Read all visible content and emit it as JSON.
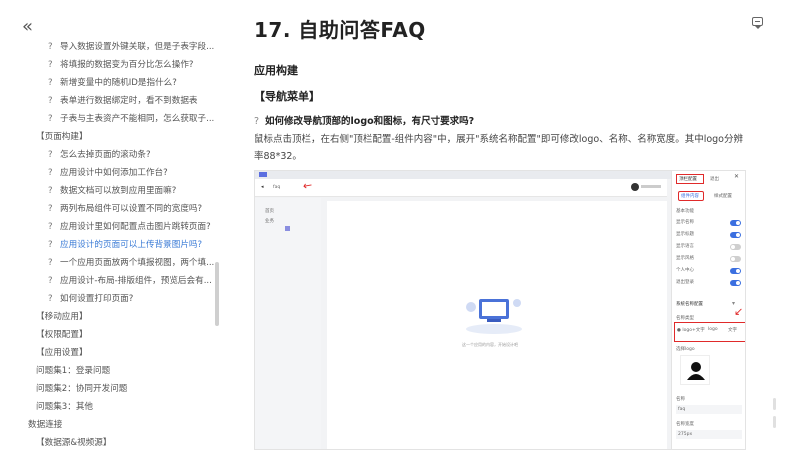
{
  "sidebar": {
    "items": [
      {
        "text": "导入数据设置外键关联，但是子表字段...",
        "type": "q"
      },
      {
        "text": "将填报的数据变为百分比怎么操作?",
        "type": "q"
      },
      {
        "text": "新增变量中的随机ID是指什么?",
        "type": "q"
      },
      {
        "text": "表单进行数据绑定时，看不到数据表",
        "type": "q"
      },
      {
        "text": "子表与主表资产不能相同，怎么获取子...",
        "type": "q"
      },
      {
        "text": "【页面构建】",
        "type": "cat"
      },
      {
        "text": "怎么去掉页面的滚动条?",
        "type": "q"
      },
      {
        "text": "应用设计中如何添加工作台?",
        "type": "q"
      },
      {
        "text": "数据文档可以放到应用里面嘛?",
        "type": "q"
      },
      {
        "text": "两列布局组件可以设置不同的宽度吗?",
        "type": "q"
      },
      {
        "text": "应用设计里如何配置点击图片跳转页面?",
        "type": "q"
      },
      {
        "text": "应用设计的页面可以上传背景图片吗?",
        "type": "q",
        "active": true
      },
      {
        "text": "一个应用页面放两个填报视图，两个填...",
        "type": "q"
      },
      {
        "text": "应用设计-布局-排版组件，预览后会有...",
        "type": "q"
      },
      {
        "text": "如何设置打印页面?",
        "type": "q"
      },
      {
        "text": "【移动应用】",
        "type": "cat"
      },
      {
        "text": "【权限配置】",
        "type": "cat"
      },
      {
        "text": "【应用设置】",
        "type": "cat"
      },
      {
        "text": "问题集1：登录问题",
        "type": "set"
      },
      {
        "text": "问题集2：协同开发问题",
        "type": "set"
      },
      {
        "text": "问题集3：其他",
        "type": "set"
      },
      {
        "text": "数据连接",
        "type": "top"
      },
      {
        "text": "【数据源&视频源】",
        "type": "cat"
      }
    ]
  },
  "main": {
    "title": "17. 自助问答FAQ",
    "section": "应用构建",
    "subsection": "【导航菜单】",
    "question": "如何修改导航顶部的logo和图标，有尺寸要求吗?",
    "answer": "鼠标点击顶栏，在右侧\"顶栏配置-组件内容\"中，展开\"系统名称配置\"即可修改logo、名称、名称宽度。其中logo分辨率88*32。"
  },
  "screenshot": {
    "app_name": "faq",
    "nav_items": [
      "首页",
      "业务"
    ],
    "panel_title": "顶栏配置",
    "panel_tab2": "退出",
    "tab_content": "组件内容",
    "tab_style": "样式配置",
    "section_basic": "基本功能",
    "rows": [
      {
        "label": "显示名称",
        "on": true
      },
      {
        "label": "显示标题",
        "on": true
      },
      {
        "label": "显示语言",
        "on": false
      },
      {
        "label": "显示风格",
        "on": false
      },
      {
        "label": "个人中心",
        "on": true
      },
      {
        "label": "退出登录",
        "on": true
      }
    ],
    "system_name_config": "系统名称配置",
    "name_type": "名称类型",
    "radio_1": "logo+文字",
    "radio_2": "logo",
    "radio_3": "文字",
    "upload_logo": "选择logo",
    "name_label": "名称",
    "name_value": "faq",
    "width_label": "名称宽度",
    "width_value": "275px",
    "empty_text": "这一个应用的内容，开始设计吧",
    "colors": {
      "accent": "#3b6fe0",
      "highlight": "#e02a2a"
    }
  }
}
